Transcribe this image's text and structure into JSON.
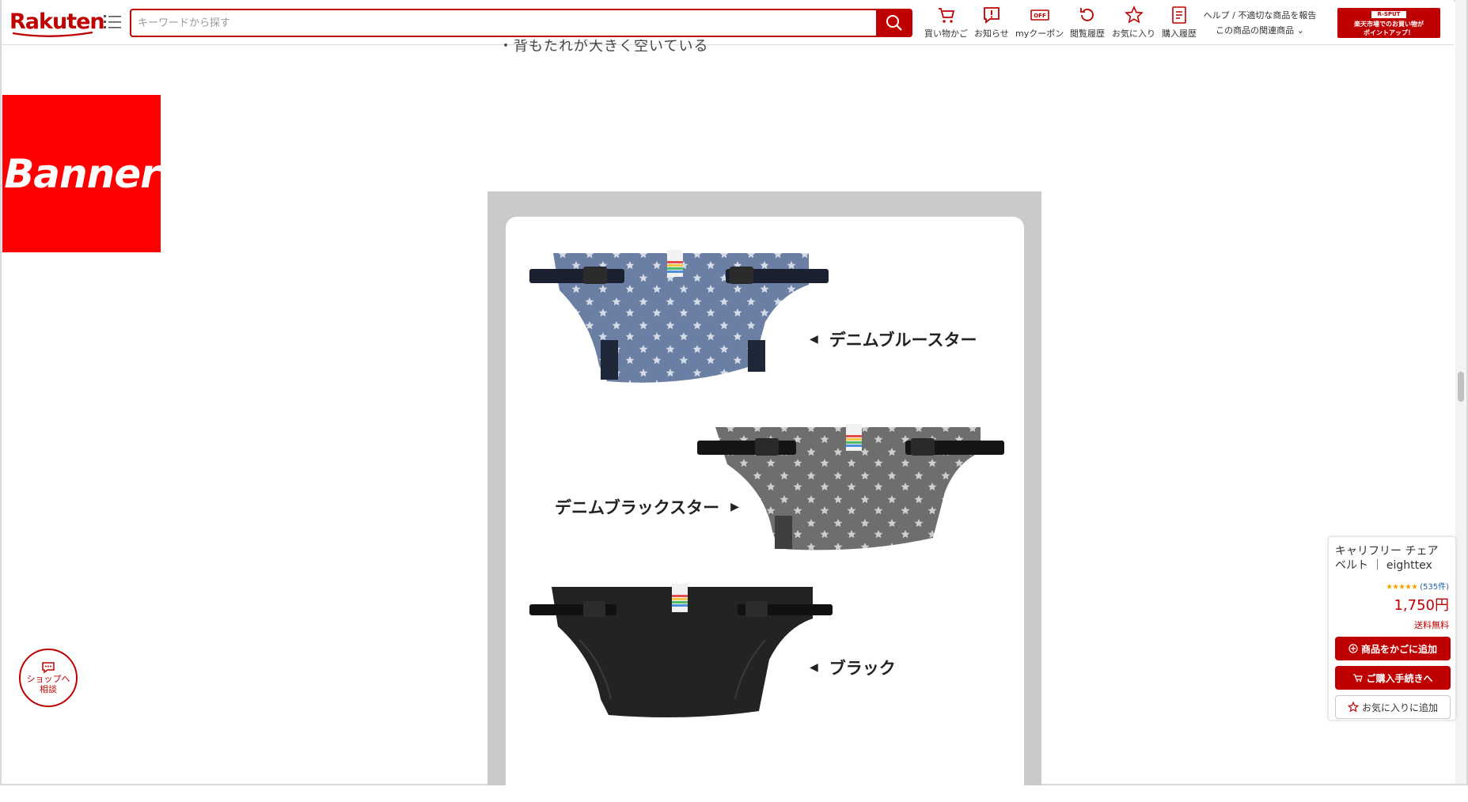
{
  "header": {
    "logo_text": "Rakuten",
    "search_placeholder": "キーワードから探す",
    "nav": [
      {
        "label": "買い物かご",
        "icon": "cart-icon"
      },
      {
        "label": "お知らせ",
        "icon": "notice-icon"
      },
      {
        "label": "myクーポン",
        "icon": "coupon-icon"
      },
      {
        "label": "閲覧履歴",
        "icon": "history-icon"
      },
      {
        "label": "お気に入り",
        "icon": "star-icon"
      },
      {
        "label": "購入履歴",
        "icon": "purchase-history-icon"
      }
    ],
    "help_line1": "ヘルプ / 不適切な商品を報告",
    "help_line2": "この商品の関連商品",
    "sput_top": "R-SPUT",
    "sput_line1": "楽天市場でのお買い物が",
    "sput_line2": "ポイントアップ！"
  },
  "content": {
    "cut_text": "・背もたれが大きく空いている",
    "banner_text": "Banner",
    "variants": [
      {
        "name": "デニムブルースター",
        "arrow": "◀",
        "color": "#6a7fa3"
      },
      {
        "name": "デニムブラックスター",
        "arrow": "▶",
        "color": "#6e6e6e"
      },
      {
        "name": "ブラック",
        "arrow": "◀",
        "color": "#232323"
      }
    ]
  },
  "chat": {
    "line1": "ショップへ",
    "line2": "相談"
  },
  "widget": {
    "title": "キャリフリー チェアベルト ｜ eighttex 国…",
    "stars": "★★★★★",
    "review_count": "(535件)",
    "price": "1,750円",
    "shipping": "送料無料",
    "add_cart": "商品をかごに追加",
    "checkout": "ご購入手続きへ",
    "favorite": "お気に入りに追加"
  },
  "colors": {
    "brand_red": "#bf0000",
    "banner_red": "#ff0000",
    "panel_gray": "#c9cbcb"
  }
}
